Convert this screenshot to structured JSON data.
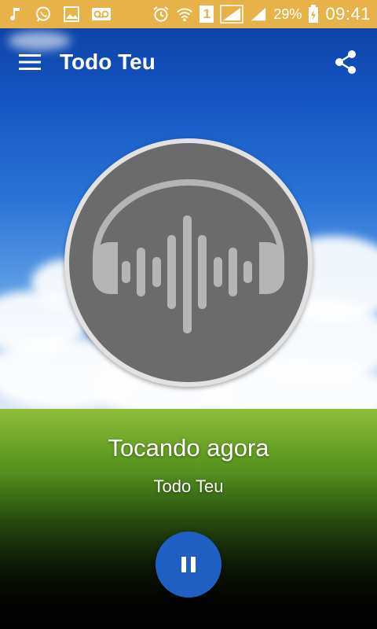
{
  "status_bar": {
    "icons": [
      "music-note-icon",
      "whatsapp-icon",
      "image-icon",
      "voicemail-icon",
      "alarm-icon",
      "wifi-icon",
      "sim-1-icon",
      "signal-icon",
      "signal-icon",
      "battery-charging-icon"
    ],
    "sim_label": "1",
    "battery_percent": "29%",
    "time": "09:41",
    "color": "#e8b24a"
  },
  "app_bar": {
    "title": "Todo Teu",
    "menu_icon": "hamburger-menu-icon",
    "share_icon": "share-icon"
  },
  "player": {
    "artwork_icon": "headphones-soundwave-icon",
    "now_playing_label": "Tocando agora",
    "station_name": "Todo Teu",
    "pause_icon": "pause-icon",
    "button_color": "#1f5fc2"
  }
}
